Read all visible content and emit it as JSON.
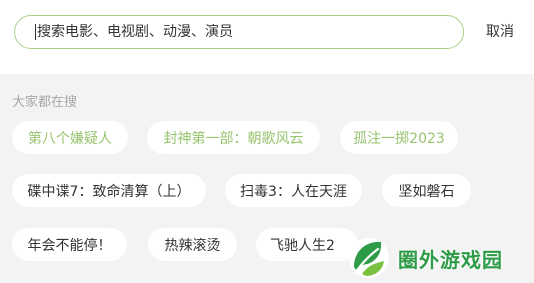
{
  "search": {
    "placeholder": "搜索电影、电视剧、动漫、演员",
    "cancel_label": "取消"
  },
  "hot_section": {
    "title": "大家都在搜",
    "items": [
      {
        "label": "第八个嫌疑人",
        "highlighted": true
      },
      {
        "label": "封神第一部：朝歌风云",
        "highlighted": true
      },
      {
        "label": "孤注一掷2023",
        "highlighted": true
      },
      {
        "label": "碟中谍7：致命清算（上）",
        "highlighted": false
      },
      {
        "label": "扫毒3：人在天涯",
        "highlighted": false
      },
      {
        "label": "坚如磐石",
        "highlighted": false
      },
      {
        "label": "年会不能停！",
        "highlighted": false
      },
      {
        "label": "热辣滚烫",
        "highlighted": false
      },
      {
        "label": "飞驰人生2",
        "highlighted": false
      }
    ]
  },
  "colors": {
    "accent": "#97c46f",
    "search_border": "#a8d18a",
    "watermark": "#2e9b47"
  },
  "watermark": {
    "text": "圈外游戏园",
    "icon": "leaf-logo-icon"
  }
}
